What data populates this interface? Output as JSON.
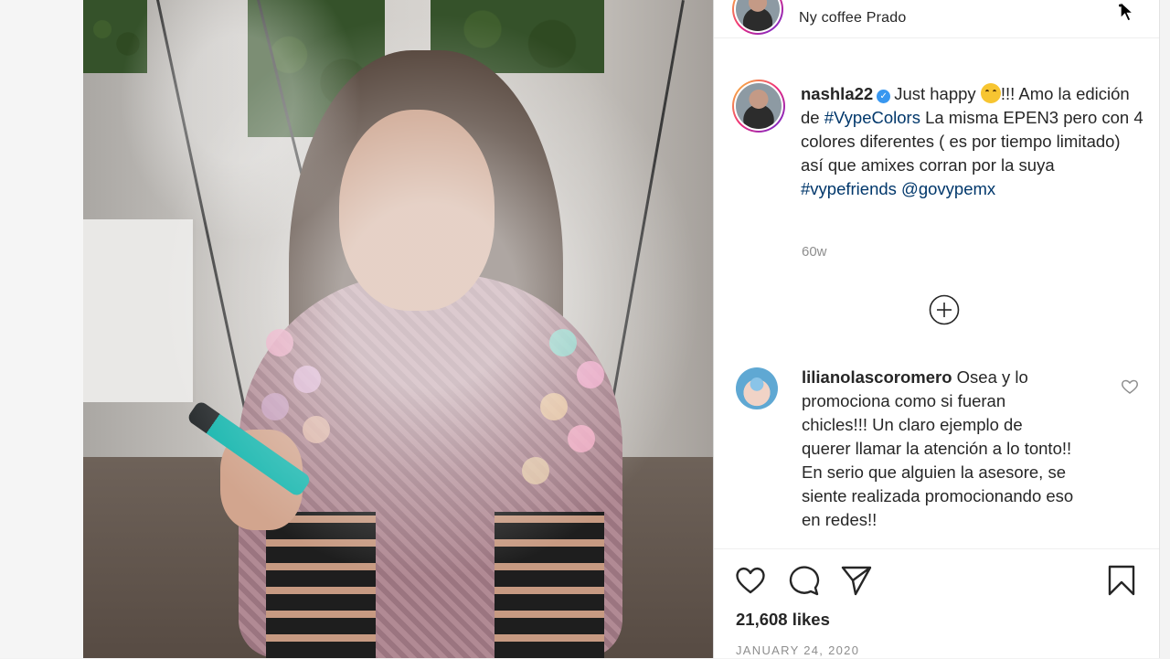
{
  "post": {
    "location": "Ny coffee Prado",
    "caption": {
      "username": "nashla22",
      "verified_icon": "verified-badge-icon",
      "text_before_emoji": "Just happy ",
      "emoji_icon": "smiling-face-emoji",
      "text_after_emoji": "!!! Amo la edición de ",
      "hashtag_1": "#VypeColors",
      "text_middle": " La misma EPEN3 pero con 4 colores diferentes ( es por tiempo limitado) así que amixes corran por la suya ",
      "hashtag_2": "#vypefriends",
      "mention": "@govypemx"
    },
    "time_ago": "60w",
    "likes": "21,608 likes",
    "date": "JANUARY 24, 2020"
  },
  "comments": [
    {
      "username": "lilianolascoromero",
      "text": " Osea y lo promociona como si fueran chicles!!! Un claro ejemplo de querer llamar la atención a lo tonto!! En serio que alguien la asesore, se siente realizada promocionando eso en redes!!"
    }
  ],
  "icons": {
    "load_more": "plus-circle-icon",
    "like": "heart-icon",
    "comment": "comment-bubble-icon",
    "share": "paper-plane-icon",
    "save": "bookmark-icon",
    "comment_like": "small-heart-icon",
    "cursor": "mouse-pointer-icon"
  },
  "colors": {
    "link": "#00376b",
    "verified": "#3897f0",
    "muted": "#8e8e8e",
    "text": "#262626"
  }
}
